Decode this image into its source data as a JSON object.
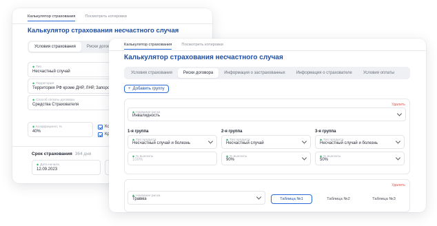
{
  "back": {
    "nav": {
      "tab1": "Калькулятор страхования",
      "tab2": "Посмотреть котировки"
    },
    "title": "Калькулятор страхования несчастного случая",
    "tabs": [
      "Условия страхования",
      "Риски договор"
    ],
    "fields": {
      "type": {
        "label": "Тип",
        "value": "Несчастный случай"
      },
      "territory": {
        "label": "Территория",
        "value": "Территория РФ кроме ДНР, ЛНР, Запорож"
      },
      "payment": {
        "label": "Способ оплаты договора",
        "value": "Средства Страхователя"
      },
      "coef": {
        "label": "Коэффициент, %",
        "value": "40%"
      }
    },
    "checks": [
      "Ко",
      "Кр"
    ],
    "term": {
      "label": "Срок страхования",
      "days": "364 дня"
    },
    "start_date": {
      "label": "Дата начала",
      "value": "12.09.2023"
    }
  },
  "front": {
    "nav": {
      "tab1": "Калькулятор страхования",
      "tab2": "Посмотреть котировки"
    },
    "title": "Калькулятор страхования несчастного случая",
    "tabs": [
      "Условия страхования",
      "Риски договора",
      "Информация о застрахованных",
      "Информация о страхователе",
      "Условия оплаты"
    ],
    "add_group": "Добавить группу",
    "panel1": {
      "delete": "Удалить",
      "risk": {
        "label": "Название риска",
        "value": "Инвалидность"
      },
      "groups": [
        {
          "title": "1-я группа",
          "product_label": "Тип продукта",
          "product": "Несчастный случай и болезнь",
          "percent_label": "% выплаты",
          "percent": "100%"
        },
        {
          "title": "2-я группа",
          "product_label": "Тип продукта",
          "product": "Несчастный случай",
          "percent_label": "% выплаты",
          "percent": "90%"
        },
        {
          "title": "3-я группа",
          "product_label": "Тип продукта",
          "product": "Несчастный случай и болезнь",
          "percent_label": "% выплаты",
          "percent": "50%"
        }
      ]
    },
    "panel2": {
      "delete": "Удалить",
      "risk": {
        "label": "Название риска",
        "value": "Травма"
      },
      "tables": [
        "Таблица №1",
        "Таблица №2",
        "Таблица №3"
      ]
    }
  }
}
